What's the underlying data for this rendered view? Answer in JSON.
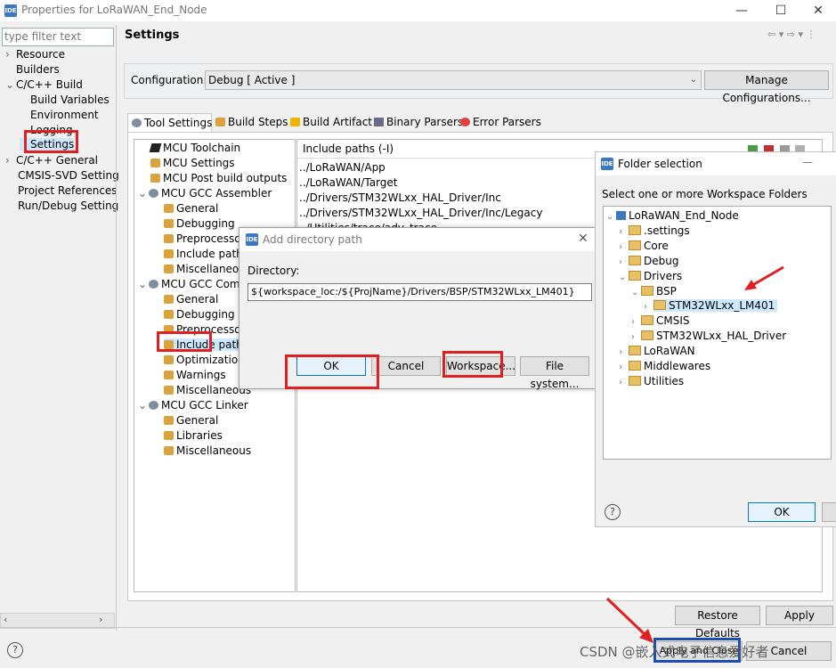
{
  "window": {
    "title": "Properties for LoRaWAN_End_Node",
    "logo_text": "IDE",
    "minimize": "—",
    "maximize": "☐",
    "close": "✕"
  },
  "filter": {
    "placeholder": "type filter text"
  },
  "nav": [
    {
      "label": "Resource",
      "twisty": "›"
    },
    {
      "label": "Builders",
      "twisty": ""
    },
    {
      "label": "C/C++ Build",
      "twisty": "⌄"
    },
    {
      "label": "Build Variables",
      "twisty": ""
    },
    {
      "label": "Environment",
      "twisty": ""
    },
    {
      "label": "Logging",
      "twisty": ""
    },
    {
      "label": "Settings",
      "twisty": ""
    },
    {
      "label": "C/C++ General",
      "twisty": "›"
    },
    {
      "label": "CMSIS-SVD Setting",
      "twisty": ""
    },
    {
      "label": "Project References",
      "twisty": ""
    },
    {
      "label": "Run/Debug Setting",
      "twisty": ""
    }
  ],
  "settings_title": "Settings",
  "header_icons": "⇦ ▾ ⇨ ▾ ⋮",
  "configuration": {
    "label": "Configuration:",
    "value": "Debug  [ Active ]",
    "manage_button": "Manage Configurations..."
  },
  "tabs": [
    {
      "label": "Tool Settings",
      "icon": "gear-icon"
    },
    {
      "label": "Build Steps",
      "icon": "wrench-icon"
    },
    {
      "label": "Build Artifact",
      "icon": "artifact-icon"
    },
    {
      "label": "Binary Parsers",
      "icon": "binary-icon"
    },
    {
      "label": "Error Parsers",
      "icon": "error-icon"
    }
  ],
  "tool_tree": [
    {
      "label": "MCU Toolchain",
      "twisty": ""
    },
    {
      "label": "MCU Settings",
      "twisty": ""
    },
    {
      "label": "MCU Post build outputs",
      "twisty": ""
    },
    {
      "label": "MCU GCC Assembler",
      "twisty": "⌄"
    },
    {
      "label": "General",
      "twisty": ""
    },
    {
      "label": "Debugging",
      "twisty": ""
    },
    {
      "label": "Preprocessor",
      "twisty": ""
    },
    {
      "label": "Include paths",
      "twisty": ""
    },
    {
      "label": "Miscellaneous",
      "twisty": ""
    },
    {
      "label": "MCU GCC Compiler",
      "twisty": "⌄"
    },
    {
      "label": "General",
      "twisty": ""
    },
    {
      "label": "Debugging",
      "twisty": ""
    },
    {
      "label": "Preprocessor",
      "twisty": ""
    },
    {
      "label": "Include paths",
      "twisty": ""
    },
    {
      "label": "Optimization",
      "twisty": ""
    },
    {
      "label": "Warnings",
      "twisty": ""
    },
    {
      "label": "Miscellaneous",
      "twisty": ""
    },
    {
      "label": "MCU GCC Linker",
      "twisty": "⌄"
    },
    {
      "label": "General",
      "twisty": ""
    },
    {
      "label": "Libraries",
      "twisty": ""
    },
    {
      "label": "Miscellaneous",
      "twisty": ""
    }
  ],
  "include_paths": {
    "header": "Include paths (-I)",
    "items": [
      "../LoRaWAN/App",
      "../LoRaWAN/Target",
      "../Drivers/STM32WLxx_HAL_Driver/Inc",
      "../Drivers/STM32WLxx_HAL_Driver/Inc/Legacy",
      "../Utilities/trace/adv_trace"
    ]
  },
  "add_dialog": {
    "title": "Add directory path",
    "directory_label": "Directory:",
    "directory_value": "${workspace_loc:/${ProjName}/Drivers/BSP/STM32WLxx_LM401}",
    "ok": "OK",
    "cancel": "Cancel",
    "workspace": "Workspace...",
    "filesystem": "File system..."
  },
  "folder_dialog": {
    "title": "Folder selection",
    "prompt": "Select one or more Workspace Folders",
    "ok": "OK",
    "tree": [
      {
        "label": "LoRaWAN_End_Node",
        "twisty": "⌄"
      },
      {
        "label": ".settings",
        "twisty": "›"
      },
      {
        "label": "Core",
        "twisty": "›"
      },
      {
        "label": "Debug",
        "twisty": "›"
      },
      {
        "label": "Drivers",
        "twisty": "⌄"
      },
      {
        "label": "BSP",
        "twisty": "⌄"
      },
      {
        "label": "STM32WLxx_LM401",
        "twisty": "›"
      },
      {
        "label": "CMSIS",
        "twisty": "›"
      },
      {
        "label": "STM32WLxx_HAL_Driver",
        "twisty": "›"
      },
      {
        "label": "LoRaWAN",
        "twisty": "›"
      },
      {
        "label": "Middlewares",
        "twisty": "›"
      },
      {
        "label": "Utilities",
        "twisty": "›"
      }
    ]
  },
  "footer": {
    "restore_defaults": "Restore Defaults",
    "apply": "Apply",
    "apply_and_close": "Apply and Close",
    "cancel": "Cancel",
    "help": "?"
  },
  "watermark": "CSDN @嵌入式电子信息爱好者",
  "colors": {
    "highlight_red": "#e02020",
    "selection_blue": "#cce8ff",
    "accent_blue": "#3b78c4"
  }
}
